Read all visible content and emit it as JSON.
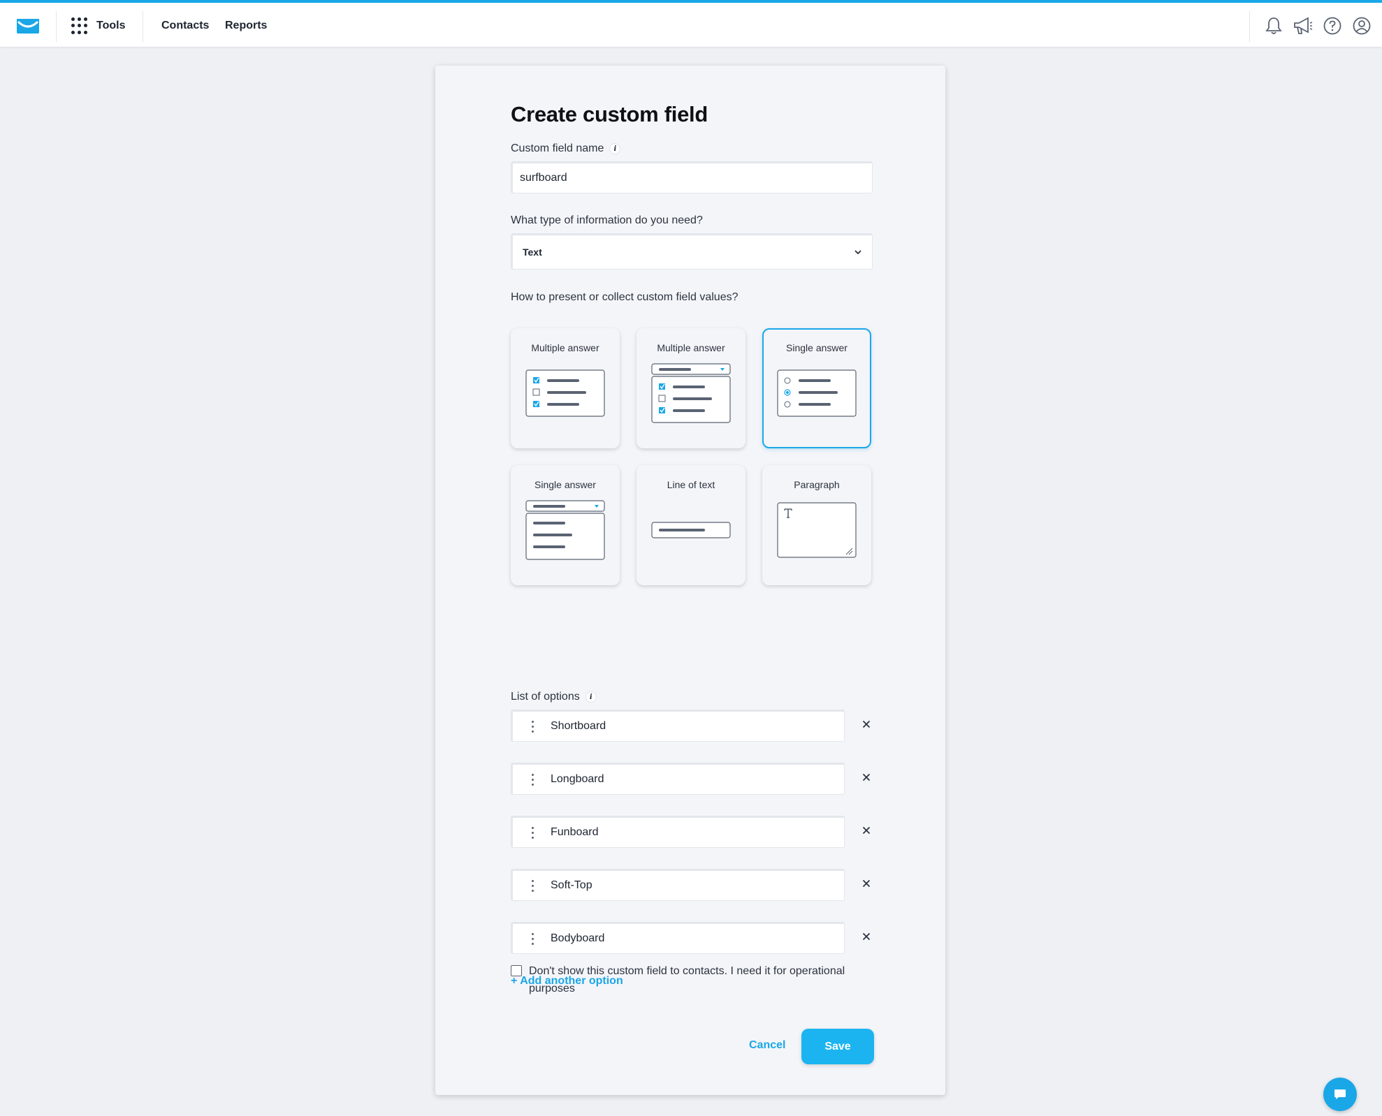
{
  "nav": {
    "tools_label": "Tools",
    "contacts_label": "Contacts",
    "reports_label": "Reports"
  },
  "form": {
    "title": "Create custom field",
    "name_label": "Custom field name",
    "name_value": "surfboard",
    "type_label": "What type of information do you need?",
    "type_value": "Text",
    "present_label": "How to present or collect custom field values?",
    "tiles": [
      {
        "label": "Multiple answer",
        "selected": false
      },
      {
        "label": "Multiple answer",
        "selected": false
      },
      {
        "label": "Single answer",
        "selected": true
      },
      {
        "label": "Single answer",
        "selected": false
      },
      {
        "label": "Line of text",
        "selected": false
      },
      {
        "label": "Paragraph",
        "selected": false
      }
    ],
    "options_label": "List of options",
    "options": [
      "Shortboard",
      "Longboard",
      "Funboard",
      "Soft-Top",
      "Bodyboard"
    ],
    "add_option_label": "+ Add another option",
    "hide_checkbox_label": "Don't show this custom field to contacts. I need it for operational purposes",
    "cancel_label": "Cancel",
    "save_label": "Save"
  },
  "colors": {
    "accent": "#1aa7e8",
    "card_bg": "#f4f5f8",
    "page_bg": "#eef0f4"
  },
  "icons": [
    "mail-logo-icon",
    "apps-grid-icon",
    "bell-icon",
    "megaphone-icon",
    "help-icon",
    "user-icon",
    "info-icon",
    "chevron-down-icon",
    "drag-handle-icon",
    "close-icon",
    "chat-icon"
  ]
}
